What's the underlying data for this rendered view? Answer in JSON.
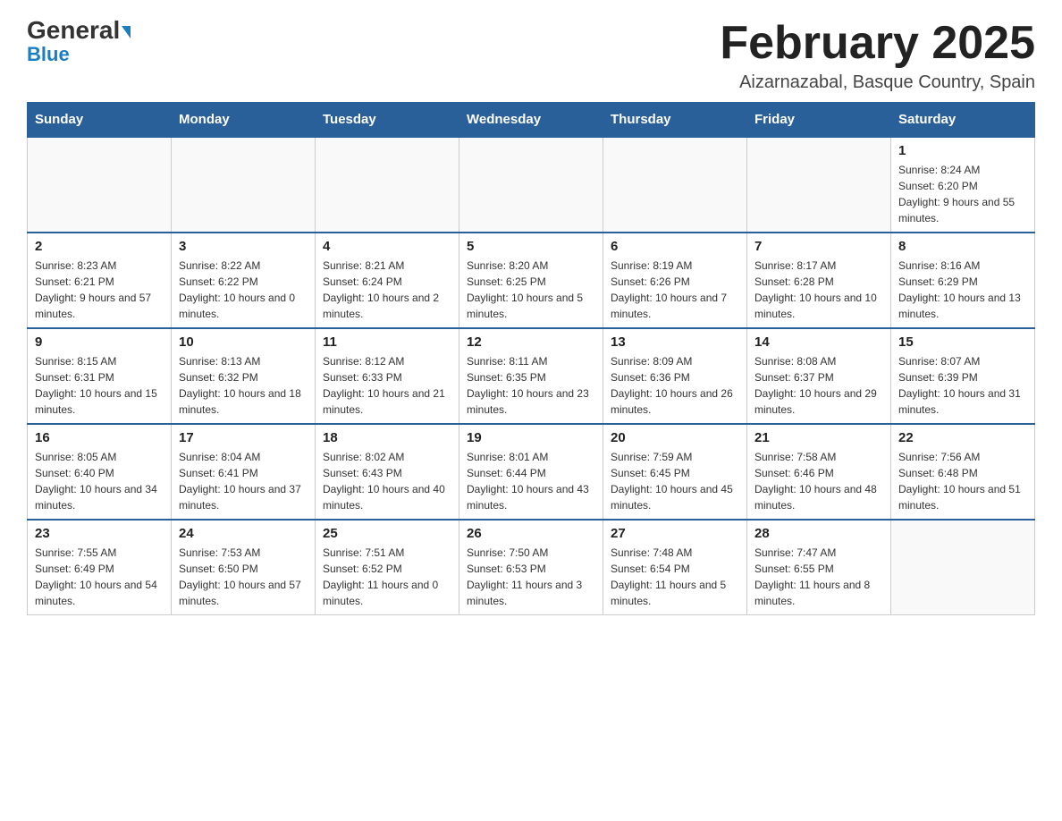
{
  "header": {
    "logo_general": "General",
    "logo_blue": "Blue",
    "month_title": "February 2025",
    "location": "Aizarnazabal, Basque Country, Spain"
  },
  "weekdays": [
    "Sunday",
    "Monday",
    "Tuesday",
    "Wednesday",
    "Thursday",
    "Friday",
    "Saturday"
  ],
  "weeks": [
    [
      {
        "day": "",
        "info": ""
      },
      {
        "day": "",
        "info": ""
      },
      {
        "day": "",
        "info": ""
      },
      {
        "day": "",
        "info": ""
      },
      {
        "day": "",
        "info": ""
      },
      {
        "day": "",
        "info": ""
      },
      {
        "day": "1",
        "info": "Sunrise: 8:24 AM\nSunset: 6:20 PM\nDaylight: 9 hours and 55 minutes."
      }
    ],
    [
      {
        "day": "2",
        "info": "Sunrise: 8:23 AM\nSunset: 6:21 PM\nDaylight: 9 hours and 57 minutes."
      },
      {
        "day": "3",
        "info": "Sunrise: 8:22 AM\nSunset: 6:22 PM\nDaylight: 10 hours and 0 minutes."
      },
      {
        "day": "4",
        "info": "Sunrise: 8:21 AM\nSunset: 6:24 PM\nDaylight: 10 hours and 2 minutes."
      },
      {
        "day": "5",
        "info": "Sunrise: 8:20 AM\nSunset: 6:25 PM\nDaylight: 10 hours and 5 minutes."
      },
      {
        "day": "6",
        "info": "Sunrise: 8:19 AM\nSunset: 6:26 PM\nDaylight: 10 hours and 7 minutes."
      },
      {
        "day": "7",
        "info": "Sunrise: 8:17 AM\nSunset: 6:28 PM\nDaylight: 10 hours and 10 minutes."
      },
      {
        "day": "8",
        "info": "Sunrise: 8:16 AM\nSunset: 6:29 PM\nDaylight: 10 hours and 13 minutes."
      }
    ],
    [
      {
        "day": "9",
        "info": "Sunrise: 8:15 AM\nSunset: 6:31 PM\nDaylight: 10 hours and 15 minutes."
      },
      {
        "day": "10",
        "info": "Sunrise: 8:13 AM\nSunset: 6:32 PM\nDaylight: 10 hours and 18 minutes."
      },
      {
        "day": "11",
        "info": "Sunrise: 8:12 AM\nSunset: 6:33 PM\nDaylight: 10 hours and 21 minutes."
      },
      {
        "day": "12",
        "info": "Sunrise: 8:11 AM\nSunset: 6:35 PM\nDaylight: 10 hours and 23 minutes."
      },
      {
        "day": "13",
        "info": "Sunrise: 8:09 AM\nSunset: 6:36 PM\nDaylight: 10 hours and 26 minutes."
      },
      {
        "day": "14",
        "info": "Sunrise: 8:08 AM\nSunset: 6:37 PM\nDaylight: 10 hours and 29 minutes."
      },
      {
        "day": "15",
        "info": "Sunrise: 8:07 AM\nSunset: 6:39 PM\nDaylight: 10 hours and 31 minutes."
      }
    ],
    [
      {
        "day": "16",
        "info": "Sunrise: 8:05 AM\nSunset: 6:40 PM\nDaylight: 10 hours and 34 minutes."
      },
      {
        "day": "17",
        "info": "Sunrise: 8:04 AM\nSunset: 6:41 PM\nDaylight: 10 hours and 37 minutes."
      },
      {
        "day": "18",
        "info": "Sunrise: 8:02 AM\nSunset: 6:43 PM\nDaylight: 10 hours and 40 minutes."
      },
      {
        "day": "19",
        "info": "Sunrise: 8:01 AM\nSunset: 6:44 PM\nDaylight: 10 hours and 43 minutes."
      },
      {
        "day": "20",
        "info": "Sunrise: 7:59 AM\nSunset: 6:45 PM\nDaylight: 10 hours and 45 minutes."
      },
      {
        "day": "21",
        "info": "Sunrise: 7:58 AM\nSunset: 6:46 PM\nDaylight: 10 hours and 48 minutes."
      },
      {
        "day": "22",
        "info": "Sunrise: 7:56 AM\nSunset: 6:48 PM\nDaylight: 10 hours and 51 minutes."
      }
    ],
    [
      {
        "day": "23",
        "info": "Sunrise: 7:55 AM\nSunset: 6:49 PM\nDaylight: 10 hours and 54 minutes."
      },
      {
        "day": "24",
        "info": "Sunrise: 7:53 AM\nSunset: 6:50 PM\nDaylight: 10 hours and 57 minutes."
      },
      {
        "day": "25",
        "info": "Sunrise: 7:51 AM\nSunset: 6:52 PM\nDaylight: 11 hours and 0 minutes."
      },
      {
        "day": "26",
        "info": "Sunrise: 7:50 AM\nSunset: 6:53 PM\nDaylight: 11 hours and 3 minutes."
      },
      {
        "day": "27",
        "info": "Sunrise: 7:48 AM\nSunset: 6:54 PM\nDaylight: 11 hours and 5 minutes."
      },
      {
        "day": "28",
        "info": "Sunrise: 7:47 AM\nSunset: 6:55 PM\nDaylight: 11 hours and 8 minutes."
      },
      {
        "day": "",
        "info": ""
      }
    ]
  ]
}
